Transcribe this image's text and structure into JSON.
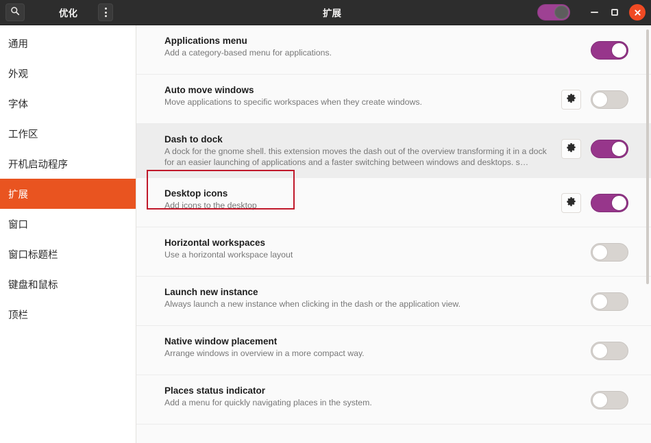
{
  "window": {
    "left_title": "优化",
    "main_title": "扩展",
    "search_icon": "search-icon",
    "menu_icon": "vertical-dots-icon",
    "master_switch_on": true,
    "controls": {
      "minimize": "minimize-icon",
      "maximize": "maximize-icon",
      "close": "close-icon"
    }
  },
  "sidebar": {
    "items": [
      {
        "label": "通用",
        "selected": false
      },
      {
        "label": "外观",
        "selected": false
      },
      {
        "label": "字体",
        "selected": false
      },
      {
        "label": "工作区",
        "selected": false
      },
      {
        "label": "开机启动程序",
        "selected": false
      },
      {
        "label": "扩展",
        "selected": true
      },
      {
        "label": "窗口",
        "selected": false
      },
      {
        "label": "窗口标题栏",
        "selected": false
      },
      {
        "label": "键盘和鼠标",
        "selected": false
      },
      {
        "label": "顶栏",
        "selected": false
      }
    ]
  },
  "extensions": [
    {
      "name": "Applications menu",
      "description": "Add a category-based menu for applications.",
      "has_gear": false,
      "enabled": true,
      "highlighted": false
    },
    {
      "name": "Auto move windows",
      "description": "Move applications to specific workspaces when they create windows.",
      "has_gear": true,
      "enabled": false,
      "highlighted": false
    },
    {
      "name": "Dash to dock",
      "description": "A dock for the gnome shell. this extension moves the dash out of the overview transforming it in a dock for an easier launching of applications and a faster switching between windows and desktops. s…",
      "has_gear": true,
      "enabled": true,
      "highlighted": true
    },
    {
      "name": "Desktop icons",
      "description": "Add icons to the desktop",
      "has_gear": true,
      "enabled": true,
      "highlighted": false
    },
    {
      "name": "Horizontal workspaces",
      "description": "Use a horizontal workspace layout",
      "has_gear": false,
      "enabled": false,
      "highlighted": false
    },
    {
      "name": "Launch new instance",
      "description": "Always launch a new instance when clicking in the dash or the application view.",
      "has_gear": false,
      "enabled": false,
      "highlighted": false
    },
    {
      "name": "Native window placement",
      "description": "Arrange windows in overview in a more compact way.",
      "has_gear": false,
      "enabled": false,
      "highlighted": false
    },
    {
      "name": "Places status indicator",
      "description": "Add a menu for quickly navigating places in the system.",
      "has_gear": false,
      "enabled": false,
      "highlighted": false
    }
  ],
  "colors": {
    "accent_orange": "#e95420",
    "toggle_purple": "#97368b",
    "titlebar": "#2d2d2d",
    "close_button": "#f04a23",
    "annotation_red": "#c0182a"
  }
}
